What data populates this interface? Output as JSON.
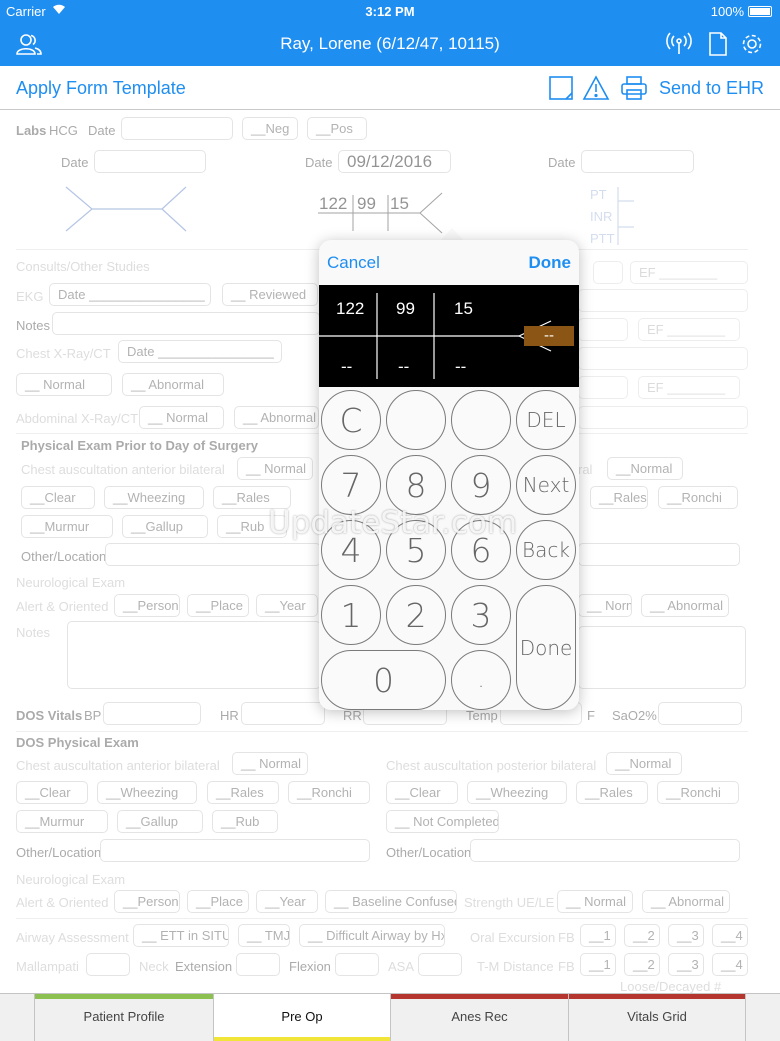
{
  "status_bar": {
    "carrier": "Carrier",
    "time": "3:12 PM",
    "battery": "100%"
  },
  "nav": {
    "title": "Ray, Lorene (6/12/47, 10115)"
  },
  "toolbar": {
    "apply": "Apply Form Template",
    "send": "Send to EHR"
  },
  "form": {
    "labs": "Labs",
    "hcg": "HCG",
    "date": "Date",
    "neg": "__Neg",
    "pos": "__Pos",
    "date_value": "09/12/2016",
    "cbc_values": [
      "122",
      "99",
      "15"
    ],
    "pt": "PT",
    "inr": "INR",
    "ptt": "PTT",
    "consults": "Consults/Other Studies",
    "ekg": "EKG",
    "ekg_date": "Date ________________",
    "reviewed": "__ Reviewed",
    "ef": "EF ________",
    "notes": "Notes",
    "chest_xray": "Chest X-Ray/CT",
    "chest_date": "Date ________________",
    "normal": "__ Normal",
    "abnormal": "__ Abnormal",
    "abd_xray": "Abdominal X-Ray/CT",
    "pe_prior": "Physical Exam Prior to Day of Surgery",
    "chest_ant": "Chest auscultation anterior bilateral",
    "chest_post": "Chest auscultation posterior bilateral",
    "ral": "ral",
    "normal2": "__Normal",
    "clear": "__Clear",
    "wheezing": "__Wheezing",
    "rales": "__Rales",
    "ronchi": "__Ronchi",
    "murmur": "__Murmur",
    "gallup": "__Gallup",
    "rub": "__Rub",
    "other_loc": "Other/Location",
    "neuro": "Neurological Exam",
    "alert": "Alert & Oriented",
    "person": "__Person",
    "place": "__Place",
    "year": "__Year",
    "dos_vitals": "DOS Vitals",
    "bp": "BP",
    "hr": "HR",
    "rr": "RR",
    "temp": "Temp",
    "f": "F",
    "sao2": "SaO2%",
    "dos_pe": "DOS Physical Exam",
    "normal3": "__ Normal",
    "not_completed": "__ Not Completed",
    "baseline": "__ Baseline Confused",
    "strength": "Strength UE/LE",
    "airway": "Airway Assessment",
    "ett": "__ ETT in SITU",
    "tmj": "__ TMJ",
    "difficult": "__ Difficult Airway by Hx",
    "oral": "Oral Excursion",
    "fb": "FB",
    "mallampati": "Mallampati",
    "neck": "Neck",
    "extension": "Extension",
    "flexion": "Flexion",
    "asa": "ASA",
    "tm": "T-M Distance",
    "fb_opts": [
      "__1",
      "__2",
      "__3",
      "__4"
    ],
    "loose": "Loose/Decayed #"
  },
  "calculator": {
    "cancel": "Cancel",
    "done": "Done",
    "top_values": [
      "122",
      "99",
      "15"
    ],
    "bottom_values": [
      "--",
      "--",
      "--"
    ],
    "selected_value": "--",
    "keys": {
      "c": "C",
      "del": "DEL",
      "seven": "7",
      "eight": "8",
      "nine": "9",
      "next": "Next",
      "four": "4",
      "five": "5",
      "six": "6",
      "back": "Back",
      "one": "1",
      "two": "2",
      "three": "3",
      "done": "Done",
      "zero": "0",
      "dot": "."
    }
  },
  "watermark": "UpdateStar.com",
  "tabs": [
    {
      "label": "Patient Profile",
      "color": "#8cc152"
    },
    {
      "label": "Pre Op",
      "color": "#f2e53a"
    },
    {
      "label": "Anes Rec",
      "color": "#b5362f"
    },
    {
      "label": "Vitals Grid",
      "color": "#b5362f"
    }
  ],
  "colors": {
    "brand": "#1f8ef1"
  }
}
